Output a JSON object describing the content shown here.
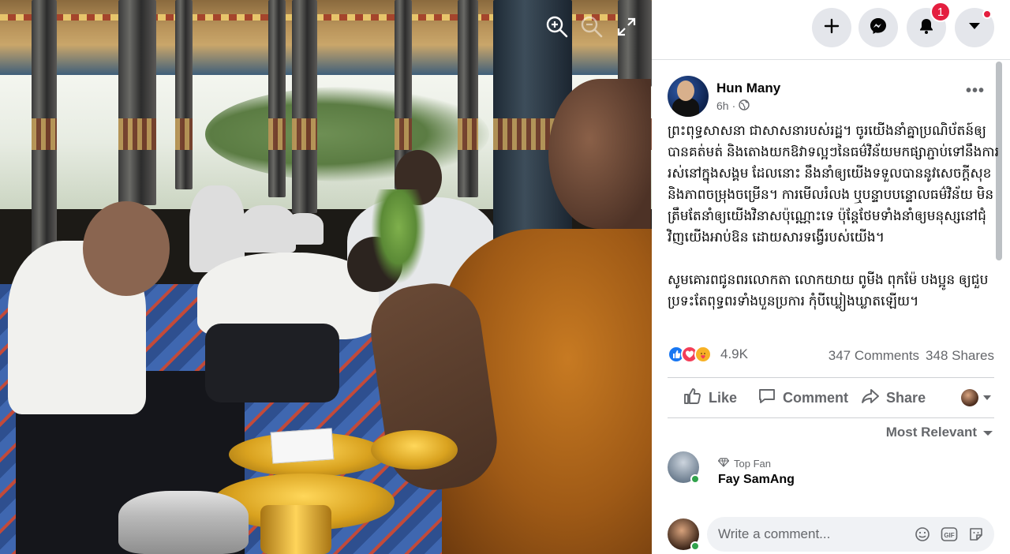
{
  "viewer": {
    "tools": [
      "zoom-in-icon",
      "zoom-out-icon",
      "fullscreen-icon"
    ]
  },
  "topbar": {
    "notification_count": "1",
    "buttons": [
      "plus-icon",
      "messenger-icon",
      "bell-icon",
      "caret-down-icon"
    ]
  },
  "post": {
    "author": "Hun Many",
    "time": "6h",
    "audience": "globe-icon",
    "paragraphs": [
      "ព្រះពុទ្ធសាសនា ជាសាសនារបស់រដ្ឋ។ ចូរយើងនាំគ្នាប្រណិប័តន៍ឲ្យបានគត់មត់ និងតោងយកឱវាទល្អៗនៃធម៌វិន័យមកផ្សាភ្ជាប់ទៅនឹងការរស់នៅក្នុងសង្គម ដែលនោះ នឹងនាំឲ្យយើងទទួលបាននូវសេចក្ដីសុខ និងភាពចម្រុងចម្រើន។ ការមើលរំលង ឬបន្ទាបបន្ទោលធម៌វិន័យ មិនត្រឹមតែនាំឲ្យយើងវិនាសប៉ុណ្ណោះទេ ប៉ុន្តែថែមទាំងនាំឲ្យមនុស្សនៅជុំវិញយើងអាប់ឱន ដោយសារទង្វើរបស់យើង។",
      "សូមគោរពជូនពរលោកតា លោកយាយ ពូមីង ពុកម៉ែ បងប្អូន ឲ្យជួបប្រទះតែពុទ្ធពរទាំងបួនប្រការ កុំបីឃ្លៀងឃ្លាតឡើយ។"
    ],
    "reaction_count": "4.9K",
    "comments": "347 Comments",
    "shares": "348 Shares"
  },
  "actions": {
    "like": "Like",
    "comment": "Comment",
    "share": "Share"
  },
  "sort_label": "Most Relevant",
  "top_comment": {
    "badge": "Top Fan",
    "name": "Fay SamAng"
  },
  "composer": {
    "placeholder": "Write a comment..."
  },
  "colors": {
    "accent": "#1877f2",
    "badge": "#e41e3f",
    "online": "#31a24c"
  }
}
